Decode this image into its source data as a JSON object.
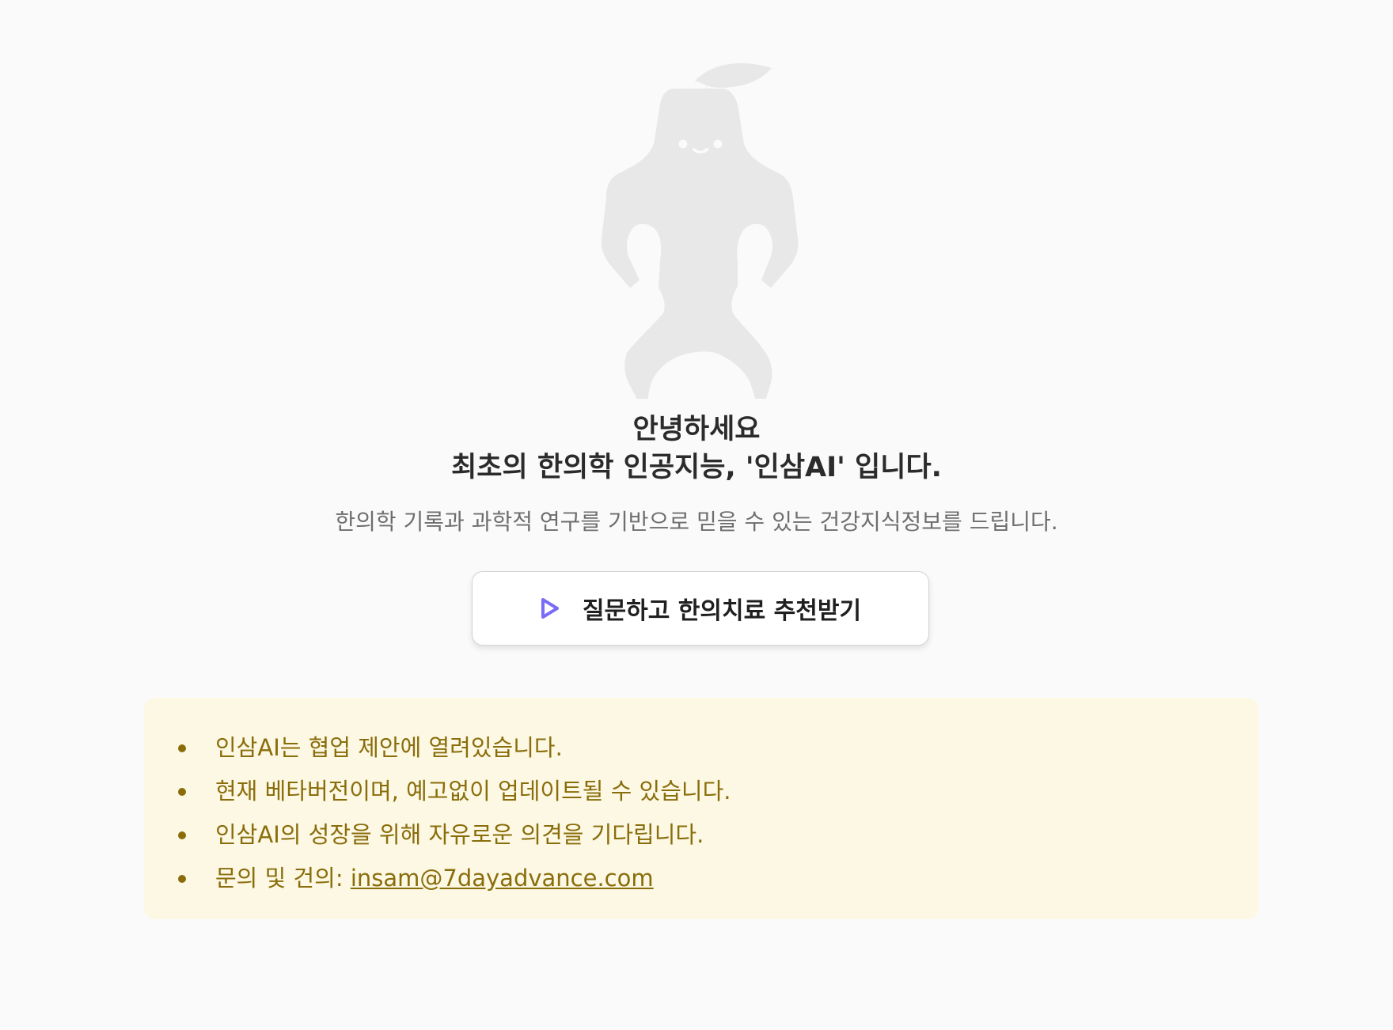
{
  "greeting": {
    "line1": "안녕하세요",
    "line2": "최초의 한의학 인공지능, '인삼AI' 입니다."
  },
  "subtitle": "한의학 기록과 과학적 연구를 기반으로 믿을 수 있는 건강지식정보를 드립니다.",
  "cta": {
    "label": "질문하고 한의치료 추천받기",
    "icon": "play-icon",
    "icon_color": "#7b6cf6"
  },
  "notice": {
    "items": [
      "인삼AI는 협업 제안에 열려있습니다.",
      "현재 베타버전이며, 예고없이 업데이트될 수 있습니다.",
      "인삼AI의 성장을 위해 자유로운 의견을 기다립니다."
    ],
    "contact_label": "문의 및 건의: ",
    "contact_email": "insam@7dayadvance.com",
    "background_color": "#fcf8e3",
    "text_color": "#8a6d0b"
  },
  "mascot": {
    "icon": "ginseng-mascot-icon",
    "color": "#e8e8e8"
  }
}
